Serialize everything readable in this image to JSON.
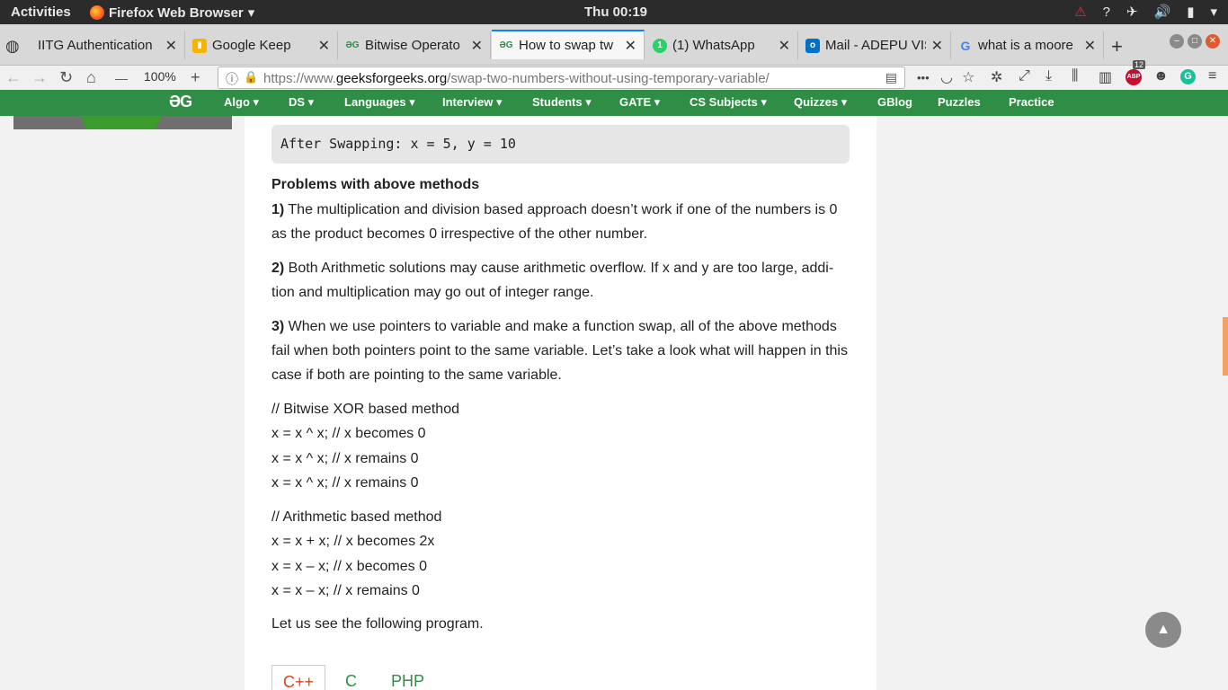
{
  "system_bar": {
    "activities": "Activities",
    "app_name": "Firefox Web Browser",
    "app_arrow": "▾",
    "clock": "Thu 00:19",
    "tray_icons": [
      "warning-icon",
      "network-icon",
      "airplane-icon",
      "volume-icon",
      "battery-icon",
      "power-icon"
    ]
  },
  "tabs": [
    {
      "title": "IITG Authentication",
      "favicon": "globe-icon"
    },
    {
      "title": "Google Keep",
      "favicon": "keep-icon"
    },
    {
      "title": "Bitwise Operato",
      "favicon": "gfg-icon"
    },
    {
      "title": "How to swap tw",
      "favicon": "gfg-icon",
      "active": true
    },
    {
      "title": "(1) WhatsApp",
      "favicon": "whatsapp-icon"
    },
    {
      "title": "Mail - ADEPU VIS",
      "favicon": "outlook-icon"
    },
    {
      "title": "what is a moore",
      "favicon": "google-icon"
    }
  ],
  "toolbar": {
    "zoom": "100%",
    "zoom_minus": "—",
    "zoom_plus": "+",
    "url_prefix": "https://www.",
    "url_domain": "geeksforgeeks.org",
    "url_path": "/swap-two-numbers-without-using-temporary-variable/",
    "more": "•••",
    "abp_count": "12",
    "abp_label": "ABP",
    "grammarly_label": "G"
  },
  "site_nav": {
    "logo": "ƏG",
    "items": [
      "Algo ▾",
      "DS ▾",
      "Languages ▾",
      "Interview ▾",
      "Students ▾",
      "GATE ▾",
      "CS Subjects ▾",
      "Quizzes ▾",
      "GBlog",
      "Puzzles",
      "Practice"
    ]
  },
  "article": {
    "output_box": "After Swapping: x = 5, y = 10",
    "problems_heading": "Problems with above methods",
    "p1_num": "1)",
    "p1_text": " The multiplication and division based approach doesn’t work if one of the numbers is 0 as the product becomes 0 irrespective of the other number.",
    "p2_num": "2)",
    "p2_text": " Both Arithmetic solutions may cause arithmetic overflow. If x and y are too large, addi-tion and multiplication may go out of integer range.",
    "p3_num": "3)",
    "p3_text": " When we use pointers to variable and make a function swap, all of the above methods fail when both pointers point to the same variable. Let’s take a look what will happen in this case if both are pointing to the same variable.",
    "xor_lines": [
      "// Bitwise XOR based method",
      "x = x ^ x; // x becomes 0",
      "x = x ^ x; // x remains 0",
      "x = x ^ x; // x remains 0"
    ],
    "arith_lines": [
      "// Arithmetic based method",
      "x = x + x; // x becomes 2x",
      "x = x – x; // x becomes 0",
      "x = x – x; // x remains 0"
    ],
    "closing": "Let us see the following program.",
    "code_tabs": [
      "C++",
      "C",
      "PHP"
    ]
  },
  "back_to_top": "▲",
  "colors": {
    "gfg_green": "#2f8d46",
    "tab_accent": "#0a84ff",
    "cpp_tab": "#e0411b"
  }
}
